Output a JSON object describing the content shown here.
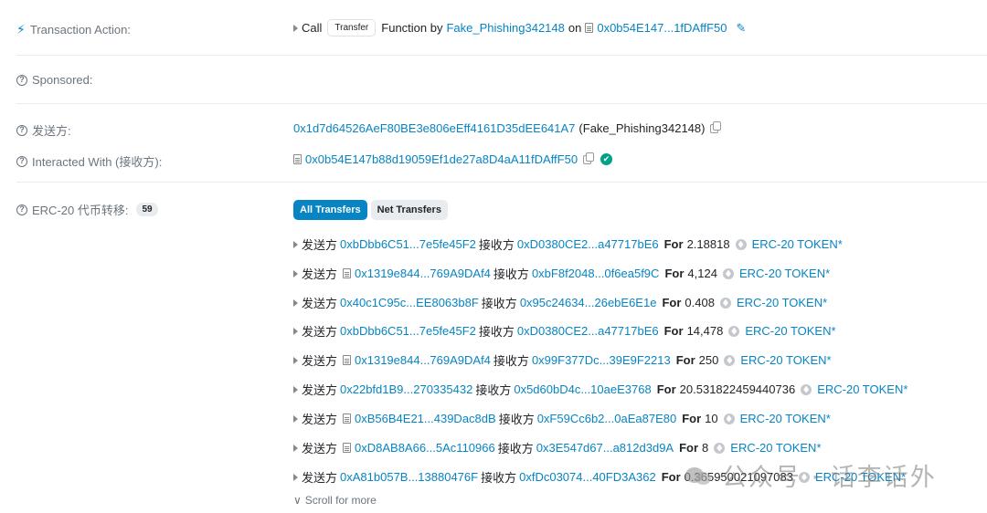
{
  "action": {
    "label": "Transaction Action:",
    "call": "Call",
    "method": "Transfer",
    "function_by": "Function by",
    "caller": "Fake_Phishing342148",
    "on": "on",
    "contract": "0x0b54E147...1fDAffF50"
  },
  "sponsored": {
    "label": "Sponsored:"
  },
  "from": {
    "label": "发送方:",
    "address": "0x1d7d64526AeF80BE3e806eEff4161D35dEE641A7",
    "tag": "(Fake_Phishing342148)"
  },
  "interacted": {
    "label": "Interacted With (接收方):",
    "address": "0x0b54E147b88d19059Ef1de27a8D4aA11fDAffF50"
  },
  "erc20": {
    "label": "ERC-20 代币转移:",
    "count": "59",
    "tabs": [
      "All Transfers",
      "Net Transfers"
    ],
    "from_word": "发送方",
    "to_word": "接收方",
    "for_word": "For",
    "transfers": [
      {
        "from": "0xbDbb6C51...7e5fe45F2",
        "from_contract": false,
        "to": "0xD0380CE2...a47717bE6",
        "amount": "2.18818",
        "token": "ERC-20 TOKEN*"
      },
      {
        "from": "0x1319e844...769A9DAf4",
        "from_contract": true,
        "to": "0xbF8f2048...0f6ea5f9C",
        "amount": "4,124",
        "token": "ERC-20 TOKEN*"
      },
      {
        "from": "0x40c1C95c...EE8063b8F",
        "from_contract": false,
        "to": "0x95c24634...26ebE6E1e",
        "amount": "0.408",
        "token": "ERC-20 TOKEN*"
      },
      {
        "from": "0xbDbb6C51...7e5fe45F2",
        "from_contract": false,
        "to": "0xD0380CE2...a47717bE6",
        "amount": "14,478",
        "token": "ERC-20 TOKEN*"
      },
      {
        "from": "0x1319e844...769A9DAf4",
        "from_contract": true,
        "to": "0x99F377Dc...39E9F2213",
        "amount": "250",
        "token": "ERC-20 TOKEN*"
      },
      {
        "from": "0x22bfd1B9...270335432",
        "from_contract": false,
        "to": "0x5d60bD4c...10aeE3768",
        "amount": "20.531822459440736",
        "token": "ERC-20 TOKEN*"
      },
      {
        "from": "0xB56B4E21...439Dac8dB",
        "from_contract": true,
        "to": "0xF59Cc6b2...0aEa87E80",
        "amount": "10",
        "token": "ERC-20 TOKEN*"
      },
      {
        "from": "0xD8AB8A66...5Ac110966",
        "from_contract": true,
        "to": "0x3E547d67...a812d3d9A",
        "amount": "8",
        "token": "ERC-20 TOKEN*"
      },
      {
        "from": "0xA81b057B...13880476F",
        "from_contract": false,
        "to": "0xfDc03074...40FD3A362",
        "amount": "0.365950021097083",
        "token": "ERC-20 TOKEN*"
      }
    ],
    "scroll_more": "Scroll for more"
  },
  "watermark": "公众号 · 话李话外"
}
